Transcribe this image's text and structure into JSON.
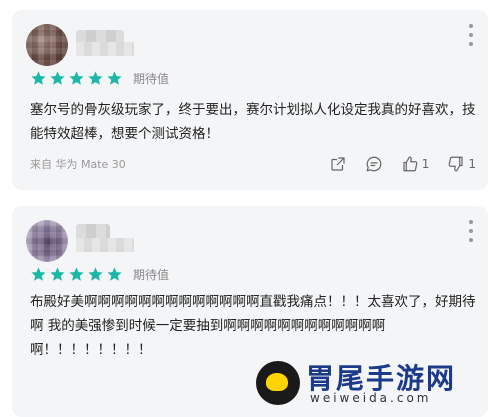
{
  "reviews": [
    {
      "rating_label": "期待值",
      "stars": 5,
      "text": "塞尔号的骨灰级玩家了，终于要出，赛尔计划拟人化设定我真的好喜欢，技能特效超棒，想要个测试资格！",
      "device": "来自 华为 Mate 30",
      "likes": "1",
      "dislikes": "1"
    },
    {
      "rating_label": "期待值",
      "stars": 5,
      "text": "布殿好美啊啊啊啊啊啊啊啊啊啊啊啊啊直戳我痛点！！！太喜欢了，好期待啊 我的美强惨到时候一定要抽到啊啊啊啊啊啊啊啊啊啊啊啊啊！！！！！！！！"
    }
  ],
  "colors": {
    "star": "#1bb8a8",
    "card_bg": "#f4f5f7",
    "text": "#222222",
    "muted": "#888888"
  },
  "icons": {
    "share": "share-icon",
    "comment": "comment-icon",
    "like": "thumb-up-icon",
    "dislike": "thumb-down-icon",
    "more": "more-vertical-icon"
  },
  "watermark": {
    "title": "胃尾手游网",
    "subtitle": "weiweida.com"
  }
}
